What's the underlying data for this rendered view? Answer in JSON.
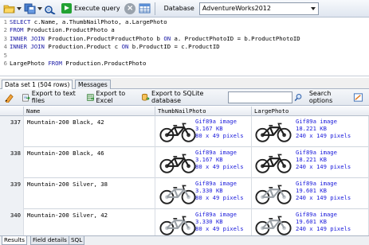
{
  "toolbar": {
    "execute_label": "Execute query",
    "database_label": "Database",
    "database_value": "AdventureWorks2012"
  },
  "editor": {
    "lines": [
      {
        "n": "1",
        "parts": [
          [
            "kw",
            "SELECT "
          ],
          [
            "id",
            "c.Name, a.ThumbNailPhoto, a.LargePhoto"
          ]
        ]
      },
      {
        "n": "2",
        "parts": [
          [
            "kw",
            "FROM "
          ],
          [
            "id",
            "Production.ProductPhoto a"
          ]
        ]
      },
      {
        "n": "3",
        "parts": [
          [
            "kw",
            "INNER JOIN "
          ],
          [
            "id",
            "Production.ProductProductPhoto b "
          ],
          [
            "kw",
            "ON "
          ],
          [
            "id",
            "a. ProductPhotoID = b.ProductPhotoID"
          ]
        ]
      },
      {
        "n": "4",
        "parts": [
          [
            "kw",
            "INNER JOIN "
          ],
          [
            "id",
            "Production.Product c "
          ],
          [
            "kw",
            "ON "
          ],
          [
            "id",
            "b.ProductID = c.ProductID"
          ]
        ]
      },
      {
        "n": "5",
        "parts": []
      },
      {
        "n": "6",
        "parts": [
          [
            "id",
            "LargePhoto "
          ],
          [
            "kw",
            "FROM "
          ],
          [
            "id",
            "Production.ProductPhoto"
          ]
        ]
      }
    ]
  },
  "tabs": {
    "dataset": "Data set 1 (504 rows)",
    "messages": "Messages"
  },
  "results_toolbar": {
    "export_text": "Export to text files",
    "export_excel": "Export to Excel",
    "export_sqlite": "Export to SQLite database",
    "search_options": "Search options",
    "filter_value": ""
  },
  "grid": {
    "headers": {
      "name": "Name",
      "thumb": "ThumbNailPhoto",
      "large": "LargePhoto"
    },
    "rows": [
      {
        "num": "337",
        "name": "Mountain-200 Black, 42",
        "thumb_info": "Gif89a image\n3.167 KB\n80 x 49 pixels",
        "large_info": "Gif89a image\n18.221 KB\n240 x 149 pixels",
        "color": "black"
      },
      {
        "num": "338",
        "name": "Mountain-200 Black, 46",
        "thumb_info": "Gif89a image\n3.167 KB\n80 x 49 pixels",
        "large_info": "Gif89a image\n18.221 KB\n240 x 149 pixels",
        "color": "black"
      },
      {
        "num": "339",
        "name": "Mountain-200 Silver, 38",
        "thumb_info": "Gif89a image\n3.330 KB\n80 x 49 pixels",
        "large_info": "Gif89a image\n19.601 KB\n240 x 149 pixels",
        "color": "silver"
      },
      {
        "num": "340",
        "name": "Mountain-200 Silver, 42",
        "thumb_info": "Gif89a image\n3.330 KB\n80 x 49 pixels",
        "large_info": "Gif89a image\n19.601 KB\n240 x 149 pixels",
        "color": "silver"
      }
    ]
  },
  "bottom_tabs": {
    "results": "Results",
    "field_details": "Field details",
    "sql": "SQL"
  },
  "colors": {
    "keyword": "#1a1aa6",
    "link_text": "#1a1adb",
    "execute_green": "#22a233"
  },
  "icons": [
    "open-folder-icon",
    "save-icon",
    "binoculars-icon",
    "execute-icon",
    "stop-icon",
    "grid-icon",
    "add-row-icon",
    "export-text-icon",
    "export-excel-icon",
    "export-sqlite-icon",
    "search-icon",
    "settings-icon"
  ]
}
